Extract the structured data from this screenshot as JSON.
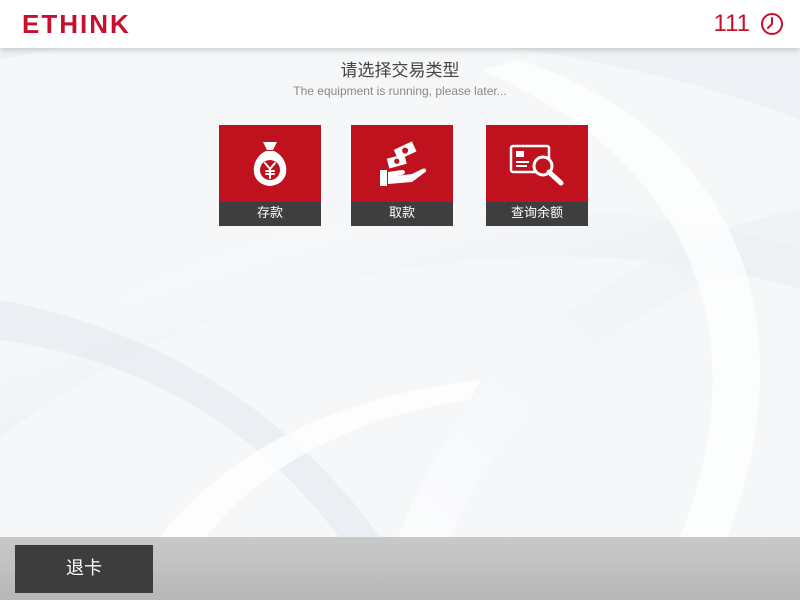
{
  "header": {
    "logo": "ETHINK",
    "countdown": "111",
    "clock_icon": "clock-icon"
  },
  "main": {
    "title": "请选择交易类型",
    "subtitle": "The equipment is running, please later...",
    "tiles": [
      {
        "label": "存款",
        "icon": "money-bag-yen-icon"
      },
      {
        "label": "取款",
        "icon": "cash-in-hand-icon"
      },
      {
        "label": "查询余额",
        "icon": "card-magnifier-icon"
      }
    ]
  },
  "footer": {
    "exit_label": "退卡"
  },
  "colors": {
    "brand_red": "#c8102e",
    "tile_red": "#c0111f",
    "tile_label_bg": "#3e3e3e",
    "footer_bg": "#bebebe",
    "button_bg": "#3d3d3d"
  }
}
